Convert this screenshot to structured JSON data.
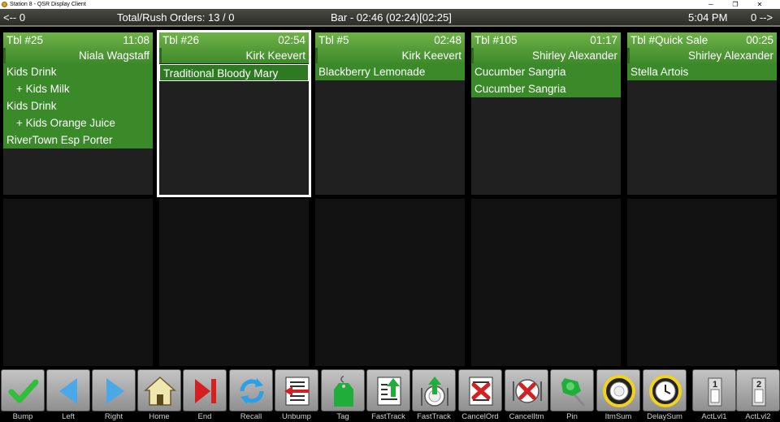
{
  "window": {
    "title": "Station 8 - QSR Display Client"
  },
  "status": {
    "prev": "<-- 0",
    "totals": "Total/Rush Orders: 13 / 0",
    "station": "Bar  - 02:46 (02:24)[02:25]",
    "clock": "5:04 PM",
    "next": "0 -->"
  },
  "tickets": [
    {
      "table": "Tbl #25",
      "time": "11:08",
      "server": "Niala Wagstaff",
      "items": [
        {
          "text": "Kids Drink",
          "mod": false
        },
        {
          "text": "+ Kids Milk",
          "mod": true
        },
        {
          "text": "Kids Drink",
          "mod": false
        },
        {
          "text": "+ Kids Orange Juice",
          "mod": true
        },
        {
          "text": "RiverTown Esp Porter",
          "mod": false
        }
      ]
    },
    {
      "table": "Tbl #26",
      "time": "02:54",
      "server": "Kirk Keevert",
      "items": [
        {
          "text": "Traditional Bloody Mary",
          "mod": false
        }
      ]
    },
    {
      "table": "Tbl #5",
      "time": "02:48",
      "server": "Kirk Keevert",
      "items": [
        {
          "text": "Blackberry Lemonade",
          "mod": false
        }
      ]
    },
    {
      "table": "Tbl #105",
      "time": "01:17",
      "server": "Shirley Alexander",
      "items": [
        {
          "text": "Cucumber Sangria",
          "mod": false
        },
        {
          "text": "Cucumber Sangria",
          "mod": false
        }
      ]
    },
    {
      "table": "Tbl #Quick Sale",
      "time": "00:25",
      "server": "Shirley Alexander",
      "items": [
        {
          "text": "Stella Artois",
          "mod": false
        }
      ]
    }
  ],
  "toolbar": [
    {
      "label": "Bump",
      "icon": "check-icon"
    },
    {
      "label": "Left",
      "icon": "arrow-left-icon"
    },
    {
      "label": "Right",
      "icon": "arrow-right-icon"
    },
    {
      "label": "Home",
      "icon": "home-icon"
    },
    {
      "label": "End",
      "icon": "end-icon"
    },
    {
      "label": "Recall",
      "icon": "recall-icon"
    },
    {
      "label": "Unbump",
      "icon": "unbump-icon"
    },
    {
      "label": "Tag",
      "icon": "tag-icon"
    },
    {
      "label": "FastTrack",
      "icon": "fasttrack-list-icon"
    },
    {
      "label": "FastTrack",
      "icon": "fasttrack-plate-icon"
    },
    {
      "label": "CancelOrd",
      "icon": "cancel-order-icon"
    },
    {
      "label": "CancelItm",
      "icon": "cancel-item-icon"
    },
    {
      "label": "Pin",
      "icon": "pin-icon"
    },
    {
      "label": "ItmSum",
      "icon": "item-summary-icon"
    },
    {
      "label": "DelaySum",
      "icon": "delay-summary-icon"
    },
    {
      "label": "ActLvl1",
      "icon": "action-level-1-icon",
      "badge": "1"
    },
    {
      "label": "ActLvl2",
      "icon": "action-level-2-icon",
      "badge": "2"
    }
  ],
  "colors": {
    "ticket_header": "#4f9a36",
    "item_bg": "#3a8a2a",
    "check": "#2fbf3a",
    "arrow": "#4aa8e8",
    "end": "#d42020",
    "yellow_ring": "#f2d21a"
  }
}
